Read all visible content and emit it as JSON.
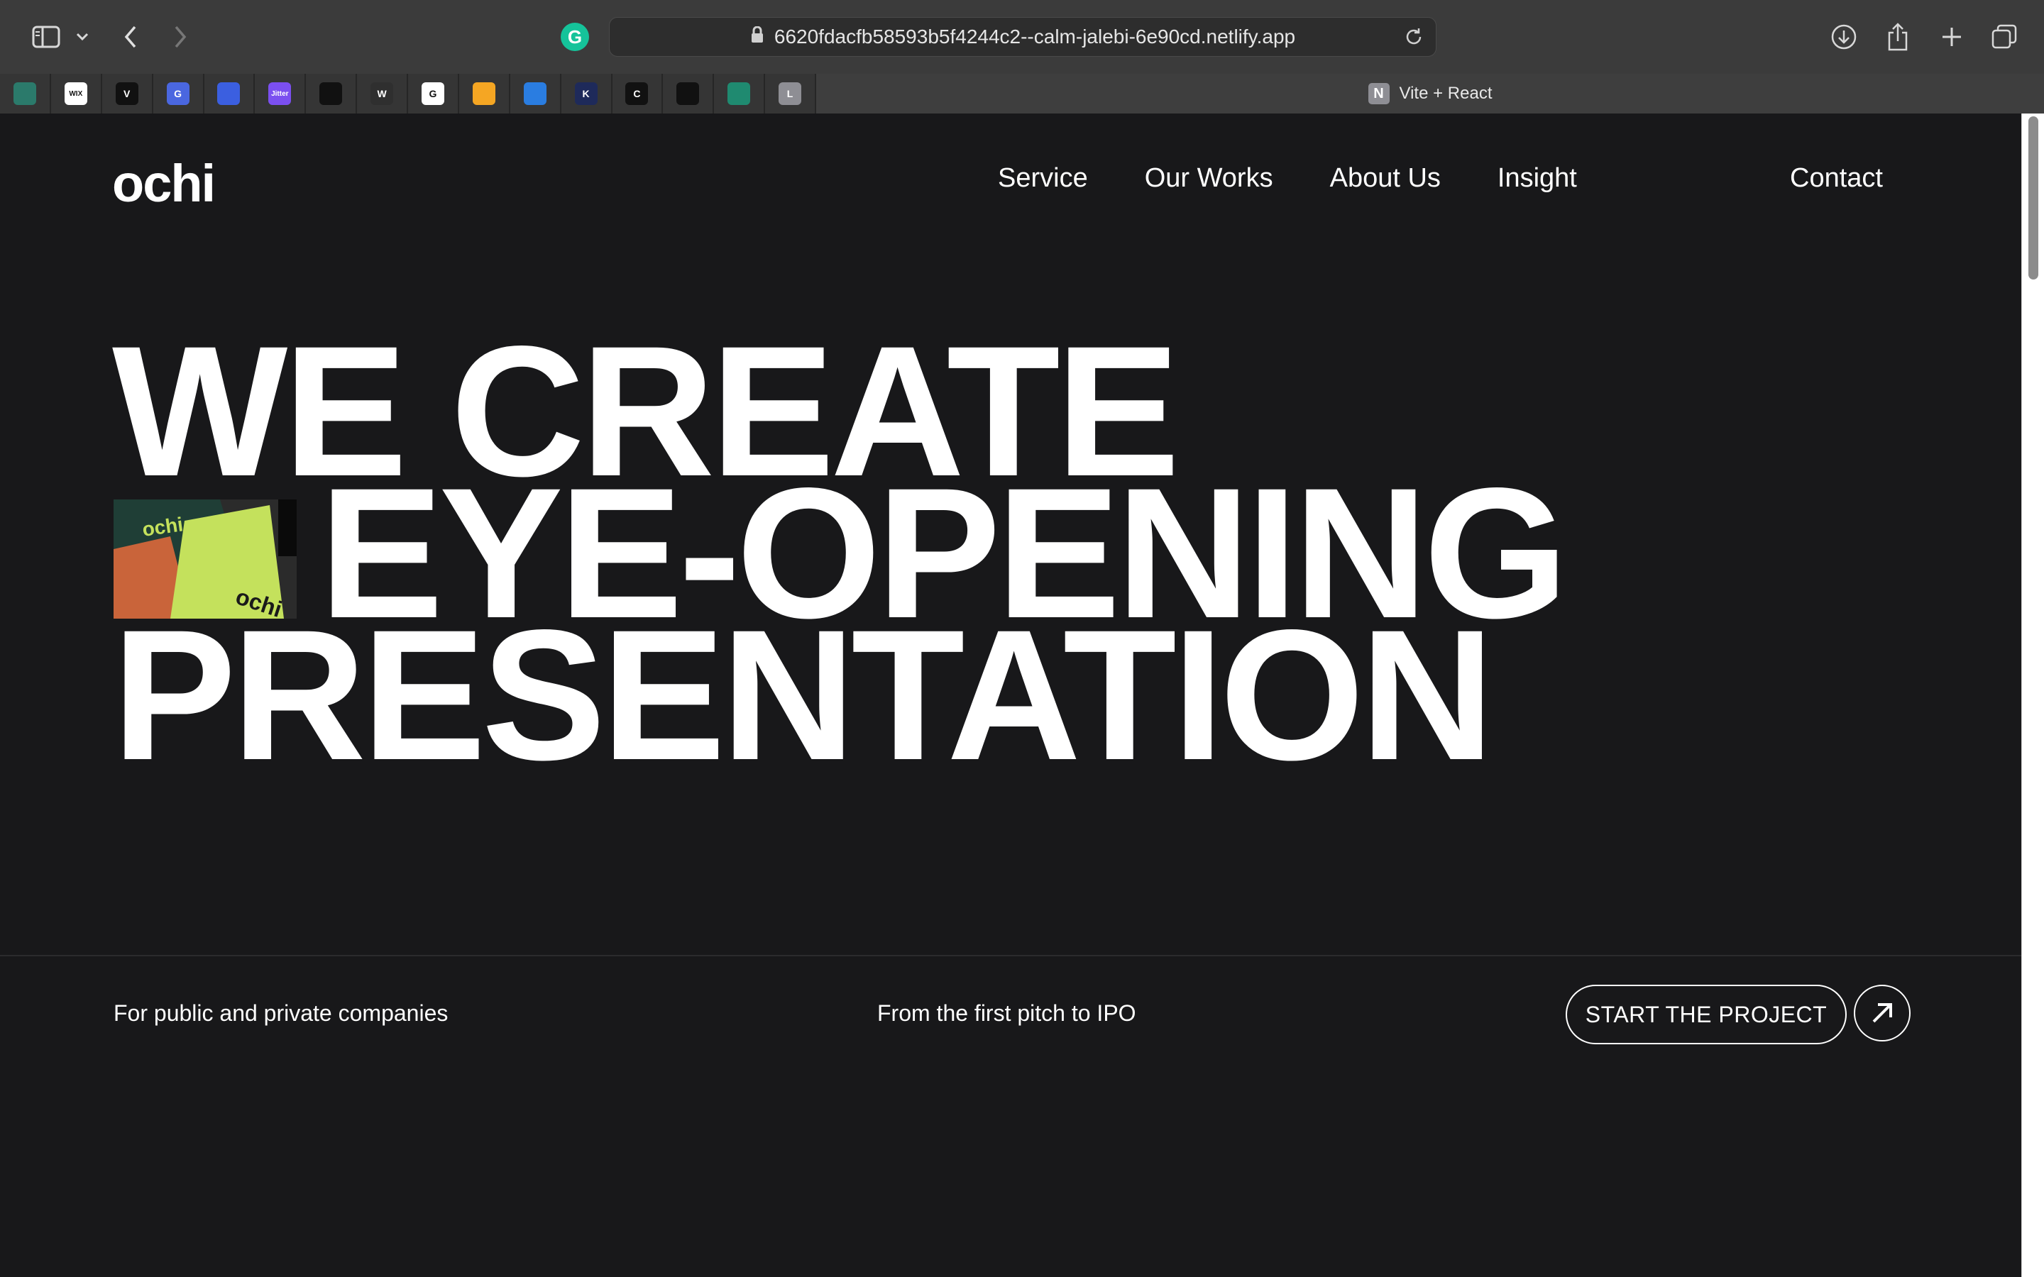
{
  "browser": {
    "url": "6620fdacfb58593b5f4244c2--calm-jalebi-6e90cd.netlify.app",
    "active_tab_title": "Vite + React",
    "active_tab_favicon": "N",
    "pinned_tabs": [
      {
        "icon": "mountain-icon",
        "letter": "",
        "color": "#2b7a6b"
      },
      {
        "icon": "wix-icon",
        "letter": "WIX",
        "color": "#ffffff"
      },
      {
        "icon": "v-logo-icon",
        "letter": "V",
        "color": "#111111"
      },
      {
        "icon": "grammarly-icon",
        "letter": "G",
        "color": "#4a67e0"
      },
      {
        "icon": "app-icon",
        "letter": "",
        "color": "#3b5fe0"
      },
      {
        "icon": "jitter-icon",
        "letter": "Jitter",
        "color": "#7b4ff0"
      },
      {
        "icon": "packs-icon",
        "letter": "",
        "color": "#111111"
      },
      {
        "icon": "w-icon",
        "letter": "W",
        "color": "#2f2f2f"
      },
      {
        "icon": "google-icon",
        "letter": "G",
        "color": "#ffffff"
      },
      {
        "icon": "pie-icon",
        "letter": "",
        "color": "#f5a623"
      },
      {
        "icon": "scissors-icon",
        "letter": "",
        "color": "#2a7de1"
      },
      {
        "icon": "k-icon",
        "letter": "K",
        "color": "#1e2a5a"
      },
      {
        "icon": "c-icon",
        "letter": "C",
        "color": "#111111"
      },
      {
        "icon": "stripe-icon",
        "letter": "",
        "color": "#111111"
      },
      {
        "icon": "x-circle-icon",
        "letter": "",
        "color": "#1f8a70"
      },
      {
        "icon": "l-icon",
        "letter": "L",
        "color": "#8e8e94"
      }
    ]
  },
  "site": {
    "logo": "ochi",
    "nav": [
      "Service",
      "Our Works",
      "About Us",
      "Insight"
    ],
    "contact": "Contact",
    "headline": [
      "WE CREATE",
      "EYE-OPENING",
      "PRESENTATION"
    ],
    "thumb_text": "ochi",
    "tagline_left": "For public and private companies",
    "tagline_middle": "From the first pitch to IPO",
    "cta": "START THE PROJECT"
  }
}
